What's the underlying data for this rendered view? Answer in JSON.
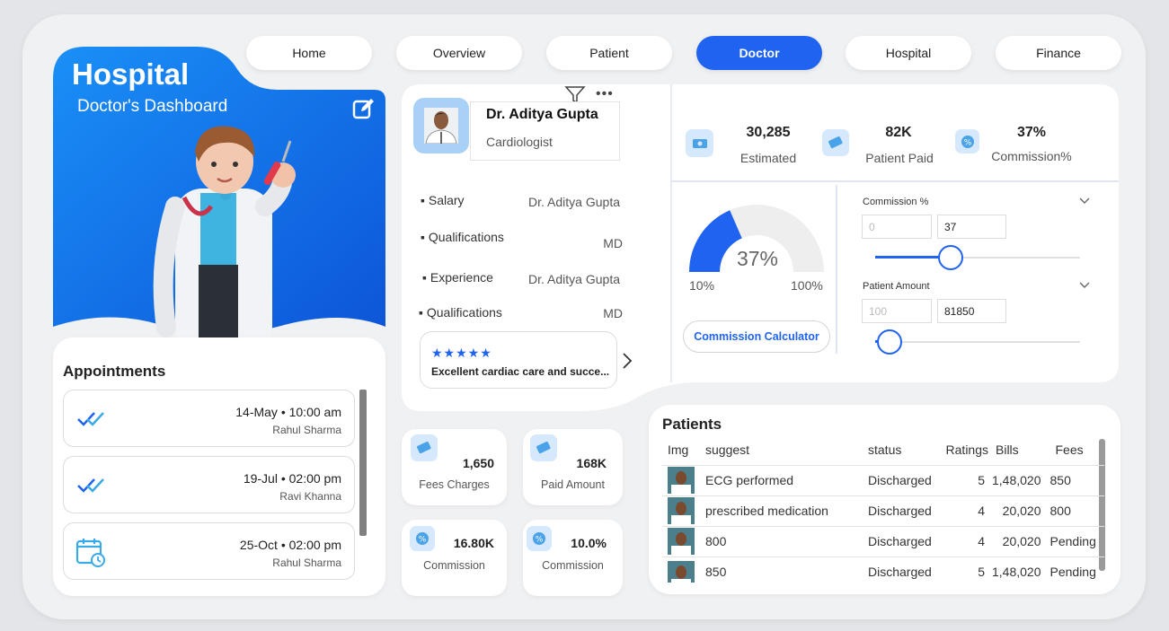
{
  "nav": {
    "items": [
      {
        "label": "Home"
      },
      {
        "label": "Overview"
      },
      {
        "label": "Patient"
      },
      {
        "label": "Doctor"
      },
      {
        "label": "Hospital"
      },
      {
        "label": "Finance"
      }
    ],
    "active": "Doctor"
  },
  "hero": {
    "title": "Hospital",
    "subtitle": "Doctor's Dashboard"
  },
  "appointments": {
    "title": "Appointments",
    "items": [
      {
        "date": "14-May • 10:00 am",
        "name": "Rahul Sharma",
        "icon": "double-check-icon"
      },
      {
        "date": "19-Jul • 02:00 pm",
        "name": "Ravi Khanna",
        "icon": "double-check-icon"
      },
      {
        "date": "25-Oct • 02:00 pm",
        "name": "Rahul Sharma",
        "icon": "calendar-clock-icon"
      }
    ]
  },
  "profile": {
    "name": "Dr. Aditya Gupta",
    "specialty": "Cardiologist",
    "details": [
      {
        "label": "Salary",
        "value": "Dr. Aditya Gupta"
      },
      {
        "label": "Qualifications",
        "value": "MD"
      },
      {
        "label": "Experience",
        "value": "Dr. Aditya Gupta"
      },
      {
        "label": "Qualifications",
        "value": "MD"
      }
    ],
    "review": {
      "stars": "★★★★★",
      "text": "Excellent cardiac care and succe..."
    }
  },
  "stats": {
    "estimated": {
      "value": "30,285",
      "label": "Estimated"
    },
    "paid": {
      "value": "82K",
      "label": "Patient Paid"
    },
    "commission": {
      "value": "37%",
      "label": "Commission%"
    }
  },
  "gauge": {
    "value": "37%",
    "min": "10%",
    "max": "100%",
    "fraction": 0.37,
    "button": "Commission Calculator"
  },
  "sliders": {
    "commission": {
      "label": "Commission %",
      "min_placeholder": "0",
      "value": "37",
      "fraction": 0.37
    },
    "patient": {
      "label": "Patient Amount",
      "min_placeholder": "100",
      "value": "81850",
      "fraction": 0.07
    }
  },
  "mini": [
    {
      "value": "1,650",
      "label": "Fees Charges"
    },
    {
      "value": "168K",
      "label": "Paid Amount"
    },
    {
      "value": "16.80K",
      "label": "Commission"
    },
    {
      "value": "10.0%",
      "label": "Commission"
    }
  ],
  "patients": {
    "title": "Patients",
    "columns": [
      "Img",
      "suggest",
      "status",
      "Ratings",
      "Bills",
      "Fees"
    ],
    "rows": [
      {
        "suggest": "ECG performed",
        "status": "Discharged",
        "rating": "5",
        "bills": "1,48,020",
        "fees": "850"
      },
      {
        "suggest": "prescribed medication",
        "status": "Discharged",
        "rating": "4",
        "bills": "20,020",
        "fees": "800"
      },
      {
        "suggest": "800",
        "status": "Discharged",
        "rating": "4",
        "bills": "20,020",
        "fees": "Pending"
      },
      {
        "suggest": "850",
        "status": "Discharged",
        "rating": "5",
        "bills": "1,48,020",
        "fees": "Pending"
      }
    ]
  },
  "colors": {
    "accent": "#1f63f0",
    "gauge_track": "#eeeeee",
    "icon_bg": "#d6e8fb"
  }
}
